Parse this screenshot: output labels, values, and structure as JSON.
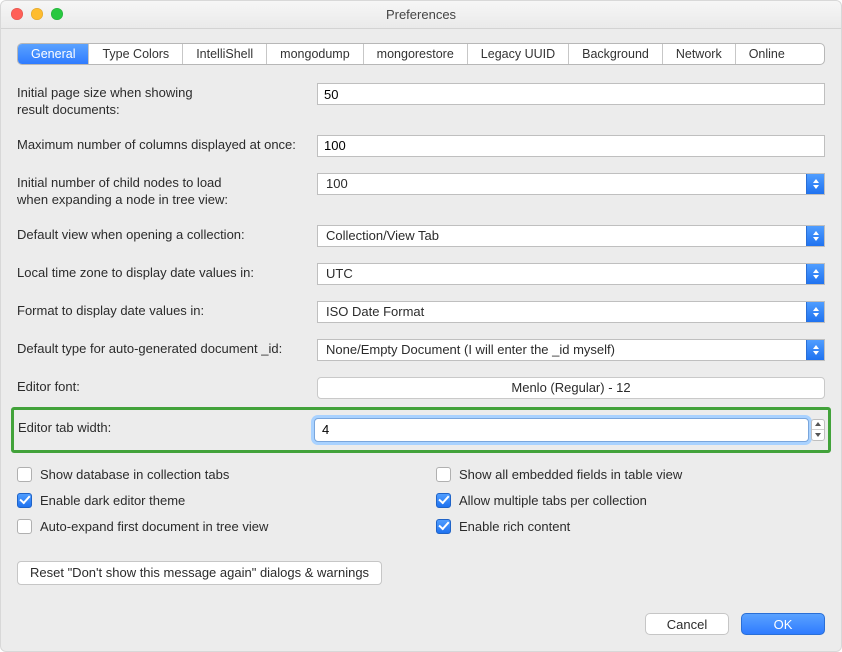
{
  "window": {
    "title": "Preferences"
  },
  "tabs": [
    {
      "label": "General",
      "selected": true
    },
    {
      "label": "Type Colors"
    },
    {
      "label": "IntelliShell"
    },
    {
      "label": "mongodump"
    },
    {
      "label": "mongorestore"
    },
    {
      "label": "Legacy UUID"
    },
    {
      "label": "Background"
    },
    {
      "label": "Network"
    },
    {
      "label": "Online"
    }
  ],
  "rows": {
    "initial_page_size": {
      "label": "Initial page size when showing\nresult documents:",
      "value": "50"
    },
    "max_columns": {
      "label": "Maximum number of columns displayed at once:",
      "value": "100"
    },
    "initial_child_nodes": {
      "label": "Initial number of child nodes to load\nwhen expanding a node in tree view:",
      "value": "100"
    },
    "default_view": {
      "label": "Default view when opening a collection:",
      "value": "Collection/View Tab"
    },
    "time_zone": {
      "label": "Local time zone to display date values in:",
      "value": "UTC"
    },
    "date_format": {
      "label": "Format to display date values in:",
      "value": "ISO Date Format"
    },
    "autogen_type": {
      "label": "Default type for auto-generated document _id:",
      "value": "None/Empty Document (I will enter the _id myself)"
    },
    "editor_font": {
      "label": "Editor font:",
      "value": "Menlo (Regular) - 12"
    },
    "editor_tab_width": {
      "label": "Editor tab width:",
      "value": "4"
    }
  },
  "checkboxes": {
    "left": [
      {
        "label": "Show database in collection tabs",
        "checked": false
      },
      {
        "label": "Enable dark editor theme",
        "checked": true
      },
      {
        "label": "Auto-expand first document in tree view",
        "checked": false
      }
    ],
    "right": [
      {
        "label": "Show all embedded fields in table view",
        "checked": false
      },
      {
        "label": "Allow multiple tabs per collection",
        "checked": true
      },
      {
        "label": "Enable rich content",
        "checked": true
      }
    ]
  },
  "buttons": {
    "reset": "Reset \"Don't show this message again\" dialogs & warnings",
    "cancel": "Cancel",
    "ok": "OK"
  }
}
